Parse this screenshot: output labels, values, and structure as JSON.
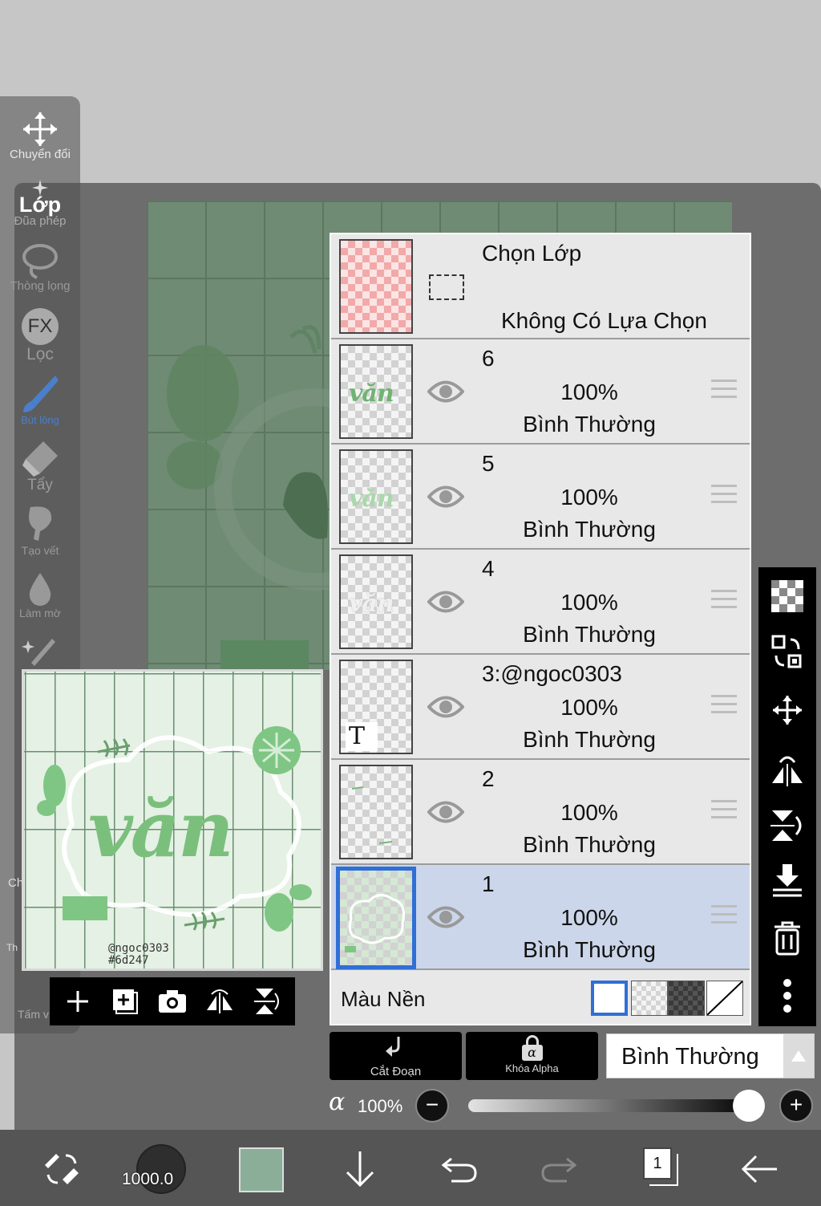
{
  "tools": [
    {
      "name": "transform-tool",
      "label": "Chuyển đổi",
      "icon": "move-arrows-icon"
    },
    {
      "name": "layer-tool",
      "label": "Lớp",
      "sub": "Đũa phép",
      "icon": "magic-wand-icon"
    },
    {
      "name": "lasso-tool",
      "label": "Thòng lọng",
      "icon": "lasso-icon"
    },
    {
      "name": "filter-tool",
      "label": "Lọc",
      "badge": "FX",
      "icon": "fx-icon"
    },
    {
      "name": "brush-tool",
      "label": "Bút lông",
      "icon": "brush-icon"
    },
    {
      "name": "eraser-tool",
      "label": "Tẩy",
      "icon": "eraser-icon"
    },
    {
      "name": "smudge-tool",
      "label": "Tạo vết",
      "icon": "smudge-icon"
    },
    {
      "name": "blur-tool",
      "label": "Làm mờ",
      "icon": "drop-icon"
    }
  ],
  "left_partial": {
    "a": "Ch",
    "b": "Th",
    "c": "Tấm v"
  },
  "preview": {
    "word": "văn",
    "credit_line1": "@ngoc0303",
    "credit_line2": "#6d247"
  },
  "selection_layer": {
    "title": "Chọn Lớp",
    "subtitle": "Không Có Lựa Chọn"
  },
  "layers": [
    {
      "number": "6",
      "opacity": "100%",
      "mode": "Bình Thường",
      "thumb": "văn"
    },
    {
      "number": "5",
      "opacity": "100%",
      "mode": "Bình Thường",
      "thumb": "văn"
    },
    {
      "number": "4",
      "opacity": "100%",
      "mode": "Bình Thường",
      "thumb": "văn"
    },
    {
      "number": "3:@ngoc0303",
      "opacity": "100%",
      "mode": "Bình Thường",
      "thumb": "T"
    },
    {
      "number": "2",
      "opacity": "100%",
      "mode": "Bình Thường",
      "thumb": ""
    },
    {
      "number": "1",
      "opacity": "100%",
      "mode": "Bình Thường",
      "thumb": "",
      "selected": true
    }
  ],
  "background": {
    "label": "Màu Nền"
  },
  "clip_button": {
    "label": "Cắt Đoạn"
  },
  "alpha_lock_button": {
    "label": "Khóa Alpha",
    "symbol": "α"
  },
  "blend_mode": {
    "value": "Bình Thường"
  },
  "opacity": {
    "symbol": "α",
    "value": "100%",
    "level": 1.0
  },
  "brush_size": "1000.0",
  "current_color": "#8aae98",
  "layer_count": "1",
  "colors": {
    "selected_row": "#cbd6ea",
    "selection_border": "#2f6fd6",
    "canvas_green": "#6f8b74"
  }
}
